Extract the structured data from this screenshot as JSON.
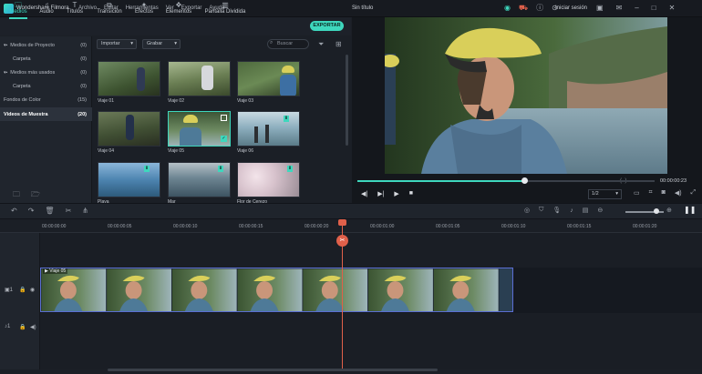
{
  "app": {
    "name": "Wondershare Filmora",
    "window_title": "Sin título",
    "login": "Iniciar sesión"
  },
  "menu": [
    "Archivo",
    "Editar",
    "Herramientas",
    "Ver",
    "Exportar",
    "Ayuda"
  ],
  "tabs": [
    {
      "label": "Medios",
      "icon": "folder-icon",
      "active": true
    },
    {
      "label": "Audio",
      "icon": "music-icon"
    },
    {
      "label": "Títulos",
      "icon": "text-icon"
    },
    {
      "label": "Transición",
      "icon": "transition-icon"
    },
    {
      "label": "Efectos",
      "icon": "effects-icon"
    },
    {
      "label": "Elementos",
      "icon": "elements-icon"
    },
    {
      "label": "Pantalla Dividida",
      "icon": "split-screen-icon"
    }
  ],
  "export_label": "EXPORTAR",
  "library": [
    {
      "label": "Medios de Proyecto",
      "count": "(0)",
      "expand": "▾ ■"
    },
    {
      "label": "Carpeta",
      "count": "(0)",
      "indent": true
    },
    {
      "label": "Medios más usados",
      "count": "(0)",
      "expand": "▾ ■"
    },
    {
      "label": "Carpeta",
      "count": "(0)",
      "indent": true
    },
    {
      "label": "Fondos de Color",
      "count": "(15)"
    },
    {
      "label": "Videos de Muestra",
      "count": "(20)",
      "selected": true
    }
  ],
  "media_toolbar": {
    "import": "Importar",
    "record": "Grabar",
    "search_placeholder": "Buscar"
  },
  "media": [
    {
      "label": "Viaje 01"
    },
    {
      "label": "Viaje 02"
    },
    {
      "label": "Viaje 03"
    },
    {
      "label": "Viaje 04"
    },
    {
      "label": "Viaje 05",
      "selected": true
    },
    {
      "label": "Viaje 06"
    },
    {
      "label": "Playa"
    },
    {
      "label": "Mar"
    },
    {
      "label": "Flor de Cerezo"
    }
  ],
  "preview": {
    "timecode": "00:00:00:23",
    "ratio": "1/2",
    "progress": 0.56
  },
  "ruler": [
    "00:00:00:00",
    "00:00:00:05",
    "00:00:00:10",
    "00:00:00:15",
    "00:00:00:20",
    "00:00:01:00",
    "00:00:01:05",
    "00:00:01:10",
    "00:00:01:15",
    "00:00:01:20"
  ],
  "clip": {
    "label": "Viaje 05"
  },
  "colors": {
    "accent": "#3ed7bd",
    "playhead": "#e0604a",
    "clip_border": "#5a6ed3"
  }
}
